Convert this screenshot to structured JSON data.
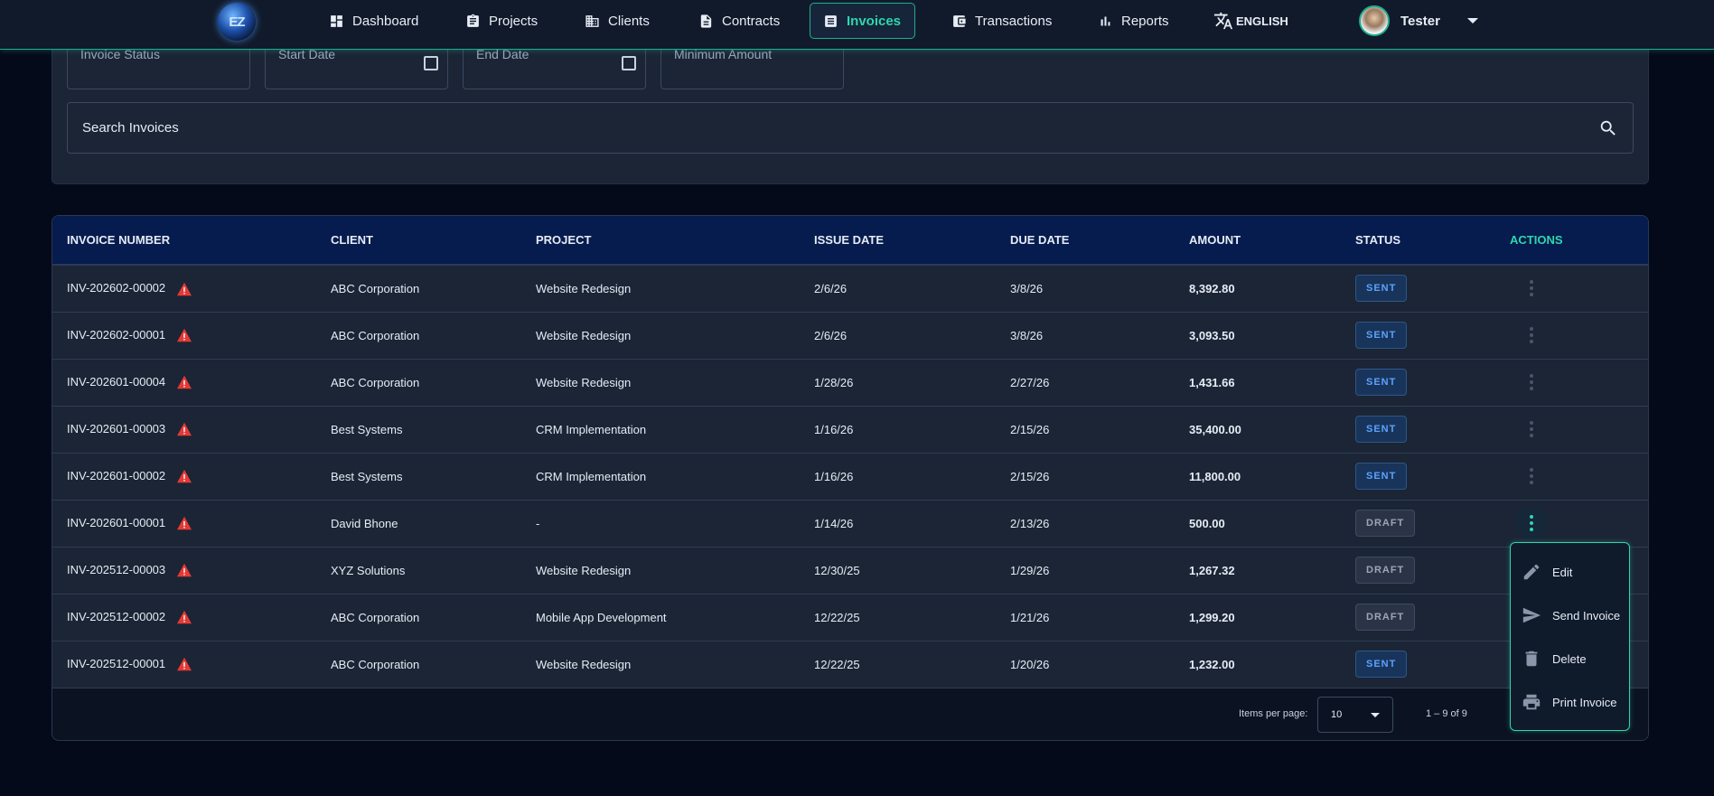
{
  "nav": {
    "items": [
      {
        "label": "Dashboard",
        "icon": "dashboard-icon"
      },
      {
        "label": "Projects",
        "icon": "clipboard-icon"
      },
      {
        "label": "Clients",
        "icon": "building-icon"
      },
      {
        "label": "Contracts",
        "icon": "document-icon"
      },
      {
        "label": "Invoices",
        "icon": "invoice-icon",
        "active": true
      },
      {
        "label": "Transactions",
        "icon": "wallet-icon"
      },
      {
        "label": "Reports",
        "icon": "bar-chart-icon"
      }
    ],
    "language": "ENGLISH",
    "user": "Tester"
  },
  "filters": {
    "status": "Invoice Status",
    "start": "Start Date",
    "end": "End Date",
    "min": "Minimum Amount"
  },
  "search": {
    "placeholder": "Search Invoices"
  },
  "table": {
    "headers": [
      "INVOICE NUMBER",
      "CLIENT",
      "PROJECT",
      "ISSUE DATE",
      "DUE DATE",
      "AMOUNT",
      "STATUS",
      "ACTIONS"
    ],
    "rows": [
      {
        "number": "INV-202602-00002",
        "client": "ABC Corporation",
        "project": "Website Redesign",
        "issue": "2/6/26",
        "due": "3/8/26",
        "amount": "8,392.80",
        "status": "SENT"
      },
      {
        "number": "INV-202602-00001",
        "client": "ABC Corporation",
        "project": "Website Redesign",
        "issue": "2/6/26",
        "due": "3/8/26",
        "amount": "3,093.50",
        "status": "SENT"
      },
      {
        "number": "INV-202601-00004",
        "client": "ABC Corporation",
        "project": "Website Redesign",
        "issue": "1/28/26",
        "due": "2/27/26",
        "amount": "1,431.66",
        "status": "SENT"
      },
      {
        "number": "INV-202601-00003",
        "client": "Best Systems",
        "project": "CRM Implementation",
        "issue": "1/16/26",
        "due": "2/15/26",
        "amount": "35,400.00",
        "status": "SENT"
      },
      {
        "number": "INV-202601-00002",
        "client": "Best Systems",
        "project": "CRM Implementation",
        "issue": "1/16/26",
        "due": "2/15/26",
        "amount": "11,800.00",
        "status": "SENT"
      },
      {
        "number": "INV-202601-00001",
        "client": "David Bhone",
        "project": "-",
        "issue": "1/14/26",
        "due": "2/13/26",
        "amount": "500.00",
        "status": "DRAFT"
      },
      {
        "number": "INV-202512-00003",
        "client": "XYZ Solutions",
        "project": "Website Redesign",
        "issue": "12/30/25",
        "due": "1/29/26",
        "amount": "1,267.32",
        "status": "DRAFT"
      },
      {
        "number": "INV-202512-00002",
        "client": "ABC Corporation",
        "project": "Mobile App Development",
        "issue": "12/22/25",
        "due": "1/21/26",
        "amount": "1,299.20",
        "status": "DRAFT"
      },
      {
        "number": "INV-202512-00001",
        "client": "ABC Corporation",
        "project": "Website Redesign",
        "issue": "12/22/25",
        "due": "1/20/26",
        "amount": "1,232.00",
        "status": "SENT"
      }
    ]
  },
  "paginator": {
    "label": "Items per page:",
    "page_size": "10",
    "range": "1 – 9 of 9"
  },
  "context_menu": {
    "items": [
      {
        "label": "Edit",
        "icon": "pencil-icon"
      },
      {
        "label": "Send Invoice",
        "icon": "send-icon"
      },
      {
        "label": "Delete",
        "icon": "trash-icon"
      },
      {
        "label": "Print Invoice",
        "icon": "printer-icon"
      }
    ]
  },
  "colors": {
    "accent": "#2fd6ad",
    "header_bg": "#061b4e",
    "sent": "#5aa2ff",
    "warning": "#e53935"
  }
}
